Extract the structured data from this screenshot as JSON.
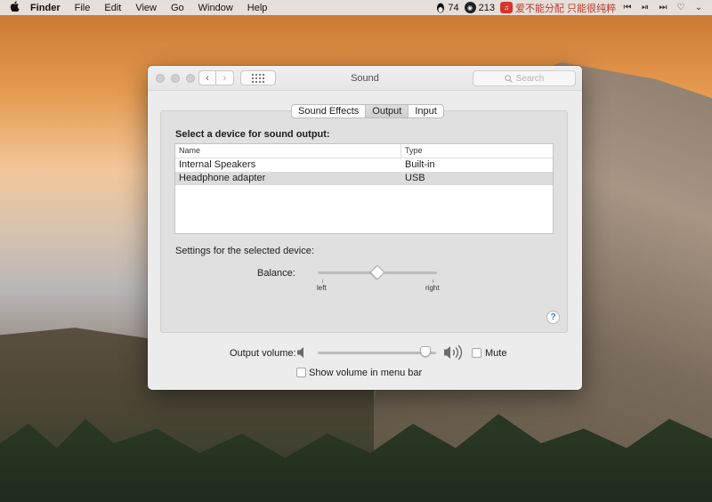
{
  "menubar": {
    "app_name": "Finder",
    "menus": [
      "File",
      "Edit",
      "View",
      "Go",
      "Window",
      "Help"
    ],
    "status": {
      "qq_count": "74",
      "netease_count": "213",
      "song_title": "爱不能分配 只能很纯粹"
    }
  },
  "window": {
    "title": "Sound",
    "search_placeholder": "Search",
    "tabs": [
      {
        "label": "Sound Effects",
        "selected": false
      },
      {
        "label": "Output",
        "selected": true
      },
      {
        "label": "Input",
        "selected": false
      }
    ],
    "device_section_label": "Select a device for sound output:",
    "table": {
      "headers": [
        "Name",
        "Type"
      ],
      "rows": [
        {
          "name": "Internal Speakers",
          "type": "Built-in",
          "selected": false
        },
        {
          "name": "Headphone adapter",
          "type": "USB",
          "selected": true
        }
      ]
    },
    "settings_label": "Settings for the selected device:",
    "balance": {
      "label": "Balance:",
      "left_label": "left",
      "right_label": "right",
      "value": 0.5
    },
    "help_label": "?",
    "output_volume": {
      "label": "Output volume:",
      "value": 0.95,
      "mute_label": "Mute",
      "muted": false
    },
    "show_volume_label": "Show volume in menu bar",
    "show_volume_checked": false
  }
}
